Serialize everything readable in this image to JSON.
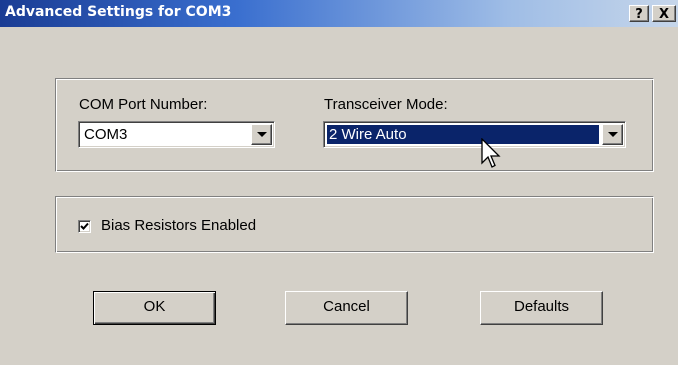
{
  "window": {
    "title": "Advanced Settings for COM3",
    "help_label": "?",
    "close_label": "X"
  },
  "port": {
    "label": "COM Port Number:",
    "value": "COM3"
  },
  "transceiver": {
    "label": "Transceiver Mode:",
    "value": "2 Wire Auto"
  },
  "bias": {
    "label": "Bias Resistors Enabled",
    "checked": true
  },
  "buttons": {
    "ok": "OK",
    "cancel": "Cancel",
    "defaults": "Defaults"
  },
  "icons": {
    "dropdown": "chevron-down-icon",
    "cursor": "mouse-pointer-icon",
    "check": "check-icon"
  },
  "colors": {
    "selection": "#0a246a",
    "face": "#d4d0c8"
  }
}
